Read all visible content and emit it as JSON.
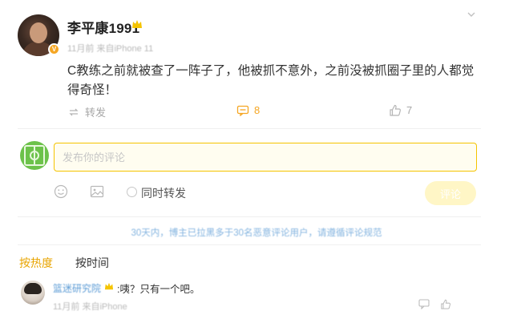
{
  "post": {
    "username": "李平康1991",
    "meta": "11月前 来自iPhone 11",
    "text": "C教练之前就被查了一阵子了，他被抓不意外，之前没被抓圈子里的人都觉得奇怪！",
    "actions": {
      "repost_label": "转发",
      "comment_count": "8",
      "like_count": "7"
    }
  },
  "composer": {
    "placeholder": "发布你的评论",
    "also_repost_label": "同时转发",
    "submit_label": "评论"
  },
  "notice": "30天内，博主已拉黑多于30名恶意评论用户，请遵循评论规范",
  "sort_tabs": [
    {
      "label": "按热度"
    },
    {
      "label": "按时间"
    }
  ],
  "comments": [
    {
      "username": "篮迷研究院",
      "text": ":咦？只有一个吧。",
      "meta": "11月前  来自iPhone"
    }
  ],
  "colors": {
    "accent": "#f5a623",
    "link": "#5b9bd5",
    "input_border": "#f5c400"
  }
}
